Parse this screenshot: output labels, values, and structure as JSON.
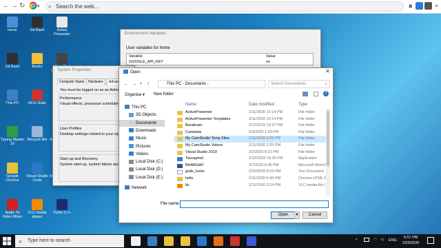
{
  "browser": {
    "search_text": "Search the web...",
    "ext_labels": [
      "a"
    ]
  },
  "desktop": {
    "icons": [
      {
        "label": "home",
        "color": "#4a90d9"
      },
      {
        "label": "Git Bash",
        "color": "#2f2f2f"
      },
      {
        "label": "Active Presenter",
        "color": "#e8e8e8"
      },
      {
        "label": "Git Bash",
        "color": "#2f2f2f"
      },
      {
        "label": "Books",
        "color": "#f0c040"
      },
      {
        "label": "WavePad Sound Editor",
        "color": "#444"
      },
      {
        "label": "This PC",
        "color": "#3a7fc8"
      },
      {
        "label": "NCH Suite",
        "color": "#cc3333"
      },
      {
        "label": "Network",
        "color": "#3a7fc8"
      },
      {
        "label": "Typing Master 10",
        "color": "#2e9e44"
      },
      {
        "label": "Recycle Bin",
        "color": "#9ab7d6"
      },
      {
        "label": "Adobe Reader XI",
        "color": "#c0282d"
      },
      {
        "label": "Google Chrome",
        "color": "#e8c23b"
      },
      {
        "label": "Visual Studio Code",
        "color": "#2a7ac7"
      },
      {
        "label": "Mozilla Firefox",
        "color": "#e86e1c"
      },
      {
        "label": "Audio To Video Mixer",
        "color": "#d02020"
      },
      {
        "label": "VLC media player",
        "color": "#f08a00"
      },
      {
        "label": "Turbo C++",
        "color": "#1d2a6d"
      }
    ]
  },
  "env_window": {
    "title": "Environment Variables",
    "section_label": "User variables for home",
    "columns": [
      "Variable",
      "Value"
    ],
    "rows": [
      [
        "GOOGLE_API_KEY",
        "no"
      ]
    ]
  },
  "sys_window": {
    "title": "System Properties",
    "tabs": [
      "Computer Name",
      "Hardware",
      "Advanced"
    ],
    "admin_note": "You must be logged on as an Administ",
    "perf_title": "Performance",
    "perf_text": "Visual effects, processor scheduling",
    "profiles_title": "User Profiles",
    "profiles_text": "Desktop settings related to your sign",
    "startup_title": "Start-up and Recovery",
    "startup_text": "System start-up, system failure and d"
  },
  "open_dialog": {
    "title": "Open",
    "path": [
      "This PC",
      "Documents"
    ],
    "search_placeholder": "Search Documents",
    "organise": "Organise ▾",
    "new_folder": "New folder",
    "nav_items": [
      {
        "label": "This PC",
        "color": "#3a7fc8"
      },
      {
        "label": "3D Objects",
        "color": "#5aa0e0"
      },
      {
        "label": "Documents",
        "color": "#d0d0d0"
      },
      {
        "label": "Downloads",
        "color": "#2d7fd3"
      },
      {
        "label": "Music",
        "color": "#3a7fc8"
      },
      {
        "label": "Pictures",
        "color": "#3a9ad8"
      },
      {
        "label": "Videos",
        "color": "#3a7fc8"
      },
      {
        "label": "Local Disk (C:)",
        "color": "#888"
      },
      {
        "label": "Local Disk (D:)",
        "color": "#888"
      },
      {
        "label": "Local Disk (E:)",
        "color": "#888"
      },
      {
        "label": "Network",
        "color": "#3a7fc8"
      }
    ],
    "columns": [
      "Name",
      "Date modified",
      "Type"
    ],
    "files": [
      {
        "name": "ActivePresenter",
        "date": "2/11/2020 10:14 PM",
        "type": "File folder",
        "icon": "#e8c34a"
      },
      {
        "name": "ActivePresenter Templates",
        "date": "2/11/2020 10:14 PM",
        "type": "File folder",
        "icon": "#e8c34a"
      },
      {
        "name": "Bandicam",
        "date": "2/12/2020 10:37 PM",
        "type": "File folder",
        "icon": "#e8c34a"
      },
      {
        "name": "Camtasia",
        "date": "2/3/2020 1:50 PM",
        "type": "File folder",
        "icon": "#e8c34a"
      },
      {
        "name": "My CamStudio Temp Files",
        "date": "2/11/2020 2:25 PM",
        "type": "File folder",
        "icon": "#e8c34a"
      },
      {
        "name": "My CamStudio Videos",
        "date": "2/11/2020 2:25 PM",
        "type": "File folder",
        "icon": "#e8c34a"
      },
      {
        "name": "Visual Studio 2019",
        "date": "2/2/2020 6:21 PM",
        "type": "File folder",
        "icon": "#e8c34a"
      },
      {
        "name": "Tavcapinst",
        "date": "2/12/2020 10:50 PM",
        "type": "Application",
        "icon": "#3a7fc8"
      },
      {
        "name": "BHARGAV",
        "date": "2/7/2020 6:36 PM",
        "type": "Microsoft Word D",
        "icon": "#2b579a"
      },
      {
        "name": "gods_fucks",
        "date": "2/22/2020 8:53 PM",
        "type": "Text Document",
        "icon": "#ffffff"
      },
      {
        "name": "hello",
        "date": "2/11/2020 6:43 PM",
        "type": "Chrome HTML Do",
        "icon": "#e8c23b"
      },
      {
        "name": "kk",
        "date": "2/11/2020 2:24 PM",
        "type": "VLC media file (",
        "icon": "#f08a00"
      }
    ],
    "selected_index": 4,
    "file_name_label": "File name:",
    "file_name_value": "",
    "open_label": "Open",
    "cancel_label": "Cancel"
  },
  "taskbar": {
    "search_placeholder": "Type here to search",
    "lang": "ENG",
    "time": "5:57 PM",
    "date": "2/23/2020",
    "apps": [
      "#f0f0f0",
      "#3a7fc8",
      "#e8c23b",
      "#f0c040",
      "#2a7ac7",
      "#e86e1c",
      "#cc3333",
      "#3a5ad8"
    ]
  },
  "colors": {
    "accent": "#0078d7",
    "selection": "#cce8ff"
  }
}
